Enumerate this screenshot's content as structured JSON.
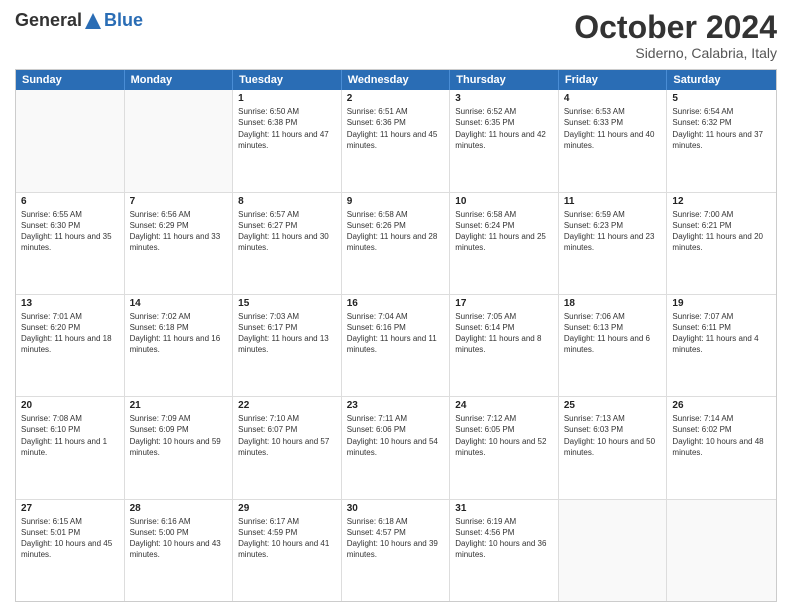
{
  "logo": {
    "general": "General",
    "blue": "Blue"
  },
  "title": "October 2024",
  "location": "Siderno, Calabria, Italy",
  "days": [
    "Sunday",
    "Monday",
    "Tuesday",
    "Wednesday",
    "Thursday",
    "Friday",
    "Saturday"
  ],
  "rows": [
    [
      {
        "day": "",
        "info": "",
        "empty": true
      },
      {
        "day": "",
        "info": "",
        "empty": true
      },
      {
        "day": "1",
        "info": "Sunrise: 6:50 AM\nSunset: 6:38 PM\nDaylight: 11 hours and 47 minutes."
      },
      {
        "day": "2",
        "info": "Sunrise: 6:51 AM\nSunset: 6:36 PM\nDaylight: 11 hours and 45 minutes."
      },
      {
        "day": "3",
        "info": "Sunrise: 6:52 AM\nSunset: 6:35 PM\nDaylight: 11 hours and 42 minutes."
      },
      {
        "day": "4",
        "info": "Sunrise: 6:53 AM\nSunset: 6:33 PM\nDaylight: 11 hours and 40 minutes."
      },
      {
        "day": "5",
        "info": "Sunrise: 6:54 AM\nSunset: 6:32 PM\nDaylight: 11 hours and 37 minutes."
      }
    ],
    [
      {
        "day": "6",
        "info": "Sunrise: 6:55 AM\nSunset: 6:30 PM\nDaylight: 11 hours and 35 minutes."
      },
      {
        "day": "7",
        "info": "Sunrise: 6:56 AM\nSunset: 6:29 PM\nDaylight: 11 hours and 33 minutes."
      },
      {
        "day": "8",
        "info": "Sunrise: 6:57 AM\nSunset: 6:27 PM\nDaylight: 11 hours and 30 minutes."
      },
      {
        "day": "9",
        "info": "Sunrise: 6:58 AM\nSunset: 6:26 PM\nDaylight: 11 hours and 28 minutes."
      },
      {
        "day": "10",
        "info": "Sunrise: 6:58 AM\nSunset: 6:24 PM\nDaylight: 11 hours and 25 minutes."
      },
      {
        "day": "11",
        "info": "Sunrise: 6:59 AM\nSunset: 6:23 PM\nDaylight: 11 hours and 23 minutes."
      },
      {
        "day": "12",
        "info": "Sunrise: 7:00 AM\nSunset: 6:21 PM\nDaylight: 11 hours and 20 minutes."
      }
    ],
    [
      {
        "day": "13",
        "info": "Sunrise: 7:01 AM\nSunset: 6:20 PM\nDaylight: 11 hours and 18 minutes."
      },
      {
        "day": "14",
        "info": "Sunrise: 7:02 AM\nSunset: 6:18 PM\nDaylight: 11 hours and 16 minutes."
      },
      {
        "day": "15",
        "info": "Sunrise: 7:03 AM\nSunset: 6:17 PM\nDaylight: 11 hours and 13 minutes."
      },
      {
        "day": "16",
        "info": "Sunrise: 7:04 AM\nSunset: 6:16 PM\nDaylight: 11 hours and 11 minutes."
      },
      {
        "day": "17",
        "info": "Sunrise: 7:05 AM\nSunset: 6:14 PM\nDaylight: 11 hours and 8 minutes."
      },
      {
        "day": "18",
        "info": "Sunrise: 7:06 AM\nSunset: 6:13 PM\nDaylight: 11 hours and 6 minutes."
      },
      {
        "day": "19",
        "info": "Sunrise: 7:07 AM\nSunset: 6:11 PM\nDaylight: 11 hours and 4 minutes."
      }
    ],
    [
      {
        "day": "20",
        "info": "Sunrise: 7:08 AM\nSunset: 6:10 PM\nDaylight: 11 hours and 1 minute."
      },
      {
        "day": "21",
        "info": "Sunrise: 7:09 AM\nSunset: 6:09 PM\nDaylight: 10 hours and 59 minutes."
      },
      {
        "day": "22",
        "info": "Sunrise: 7:10 AM\nSunset: 6:07 PM\nDaylight: 10 hours and 57 minutes."
      },
      {
        "day": "23",
        "info": "Sunrise: 7:11 AM\nSunset: 6:06 PM\nDaylight: 10 hours and 54 minutes."
      },
      {
        "day": "24",
        "info": "Sunrise: 7:12 AM\nSunset: 6:05 PM\nDaylight: 10 hours and 52 minutes."
      },
      {
        "day": "25",
        "info": "Sunrise: 7:13 AM\nSunset: 6:03 PM\nDaylight: 10 hours and 50 minutes."
      },
      {
        "day": "26",
        "info": "Sunrise: 7:14 AM\nSunset: 6:02 PM\nDaylight: 10 hours and 48 minutes."
      }
    ],
    [
      {
        "day": "27",
        "info": "Sunrise: 6:15 AM\nSunset: 5:01 PM\nDaylight: 10 hours and 45 minutes."
      },
      {
        "day": "28",
        "info": "Sunrise: 6:16 AM\nSunset: 5:00 PM\nDaylight: 10 hours and 43 minutes."
      },
      {
        "day": "29",
        "info": "Sunrise: 6:17 AM\nSunset: 4:59 PM\nDaylight: 10 hours and 41 minutes."
      },
      {
        "day": "30",
        "info": "Sunrise: 6:18 AM\nSunset: 4:57 PM\nDaylight: 10 hours and 39 minutes."
      },
      {
        "day": "31",
        "info": "Sunrise: 6:19 AM\nSunset: 4:56 PM\nDaylight: 10 hours and 36 minutes."
      },
      {
        "day": "",
        "info": "",
        "empty": true
      },
      {
        "day": "",
        "info": "",
        "empty": true
      }
    ]
  ]
}
